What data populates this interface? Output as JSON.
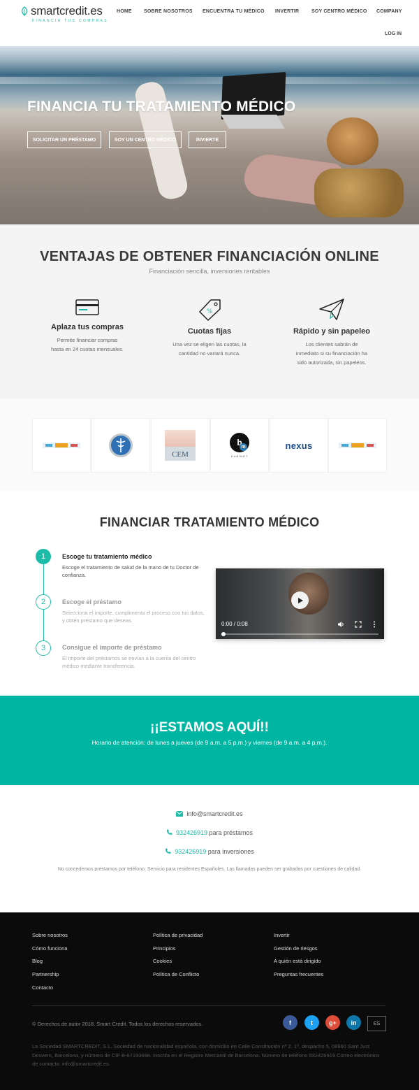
{
  "brand": {
    "name": "smartcredit.es",
    "tagline": "FINANCIA TUS COMPRAS",
    "color": "#1dbca8"
  },
  "nav": {
    "items": [
      "HOME",
      "SOBRE NOSOTROS",
      "ENCUENTRA TU MÉDICO",
      "INVERTIR",
      "SOY CENTRO MÉDICO",
      "COMPANY"
    ],
    "login": "LOG IN"
  },
  "hero": {
    "title": "FINANCIA TU TRATAMIENTO MÉDICO",
    "buttons": [
      "SOLICITAR UN PRÉSTAMO",
      "SOY UN CENTRO MÉDICO",
      "INVIERTE"
    ]
  },
  "ventajas": {
    "title": "VENTAJAS DE OBTENER FINANCIACIÓN ONLINE",
    "subtitle": "Financiación sencilla, inversiones rentables",
    "features": [
      {
        "icon": "credit-card-icon",
        "title": "Aplaza tus compras",
        "text": "Permite financiar compras hasta en 24 cuotas mensuales."
      },
      {
        "icon": "price-tag-icon",
        "title": "Cuotas fijas",
        "text": "Una vez se eligen las cuotas, la cantidad no variará nunca."
      },
      {
        "icon": "paper-plane-icon",
        "title": "Rápido y sin papeleo",
        "text": "Los clientes sabrán de inmediato si su financiación ha sido autorizada, sin papeleos."
      }
    ]
  },
  "partners": {
    "logos": [
      "aistic",
      "medical-caduceus",
      "CEM",
      "b gabinet m",
      "nexus",
      "aistic"
    ],
    "cem_text": "CEM",
    "b_text": "b",
    "m_text": "m",
    "b_caption": "GABINET",
    "nexus_text": "nexus"
  },
  "financiar": {
    "title": "FINANCIAR TRATAMIENTO MÉDICO",
    "steps": [
      {
        "num": "1",
        "title": "Escoge tu tratamiento médico",
        "text": "Escoge el tratamiento de salud de la mano de tu Doctor de confianza."
      },
      {
        "num": "2",
        "title": "Escoge el préstamo",
        "text": "Selecciona el importe, cumplimenta el proceso con tus datos, y obtén préstamo que deseas."
      },
      {
        "num": "3",
        "title": "Consigue el importe de préstamo",
        "text": "El importe del préstamos se envían a la cuenta del centro médico mediante transferencia."
      }
    ],
    "video": {
      "time": "0:00 / 0:08"
    }
  },
  "aqui": {
    "title": "¡¡ESTAMOS AQUÍ!!",
    "hours": "Horario de atención: de lunes a jueves (de 9 a.m. a 5 p.m.) y viernes (de 9 a.m. a 4 p.m.).",
    "color": "#00b5a2"
  },
  "contact": {
    "email": "info@smartcredit.es",
    "phone1": "932426919",
    "phone1_suffix": "para préstamos",
    "phone2": "932426919",
    "phone2_suffix": "para inversiones",
    "note": "No concedemos préstamos por teléfono. Servicio para residentes Españoles. Las llamadas pueden ser grabadas por cuestiones de calidad."
  },
  "footer": {
    "col1": [
      "Sobre nosotros",
      "Cómo funciona",
      "Blog",
      "Partnership",
      "Contacto"
    ],
    "col2": [
      "Política de privacidad",
      "Principios",
      "Cookies",
      "Política de Conflicto"
    ],
    "col3": [
      "Invertir",
      "Gestión de riesgos",
      "A quién está dirigido",
      "Preguntas frecuentes"
    ],
    "copyright": "© Derechos de autor 2018. Smart Credit. Todos los derechos reservados.",
    "social": [
      {
        "label": "f",
        "color": "#3b5998"
      },
      {
        "label": "t",
        "color": "#1da1f2"
      },
      {
        "label": "g+",
        "color": "#dd4b39"
      },
      {
        "label": "in",
        "color": "#0e76a8"
      }
    ],
    "lang": "ES",
    "legal": "La Sociedad SMARTCREDIT, S.L. Sociedad de nacionalidad española, con domicilio en Calle Constitución nº 2, 1º, despacho 5, 08960 Sant Just Desvern, Barcelona, y número de CIF B-67193698. Inscrita en el Registro Mercantil de Barcelona. Número de teléfono 932426919 Correo electrónico de contacto: info@smartcredit.es."
  }
}
